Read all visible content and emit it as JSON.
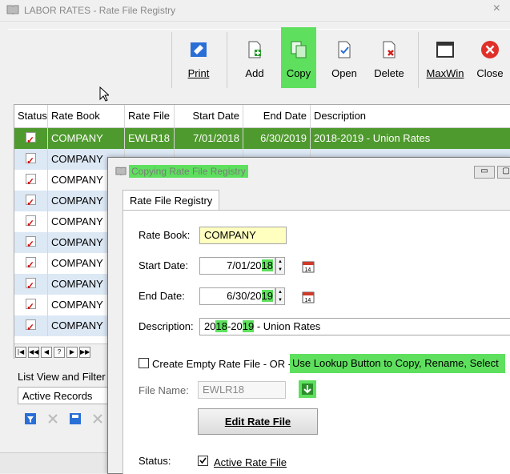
{
  "window": {
    "title": "LABOR RATES - Rate File Registry",
    "close_glyph": "×"
  },
  "toolbar": [
    {
      "id": "print",
      "label": "Print",
      "icon": "print-icon"
    },
    {
      "id": "add",
      "label": "Add",
      "icon": "add-document-icon"
    },
    {
      "id": "copy",
      "label": "Copy",
      "icon": "copy-icon"
    },
    {
      "id": "open",
      "label": "Open",
      "icon": "open-document-icon"
    },
    {
      "id": "delete",
      "label": "Delete",
      "icon": "delete-document-icon"
    },
    {
      "id": "maxwin",
      "label": "MaxWin",
      "icon": "maximize-window-icon"
    },
    {
      "id": "close",
      "label": "Close",
      "icon": "close-circle-icon"
    }
  ],
  "grid": {
    "columns": [
      "Status",
      "Rate Book",
      "Rate File",
      "Start Date",
      "End Date",
      "Description"
    ],
    "rows": [
      {
        "book": "COMPANY",
        "file": "EWLR18",
        "start": "7/01/2018",
        "end": "6/30/2019",
        "desc": "2018-2019 - Union Rates"
      },
      {
        "book": "COMPANY"
      },
      {
        "book": "COMPANY"
      },
      {
        "book": "COMPANY"
      },
      {
        "book": "COMPANY"
      },
      {
        "book": "COMPANY"
      },
      {
        "book": "COMPANY"
      },
      {
        "book": "COMPANY"
      },
      {
        "book": "COMPANY"
      },
      {
        "book": "COMPANY"
      }
    ],
    "nav_glyphs": [
      "|◀",
      "◀◀",
      "◀",
      "?",
      "▶",
      "▶▶"
    ]
  },
  "filter": {
    "label": "List View and Filter",
    "selected": "Active Records"
  },
  "dialog": {
    "title": "Copying Rate File Registry",
    "tab": "Rate File Registry",
    "rate_book_label": "Rate Book:",
    "rate_book_value": "COMPANY",
    "start_label": "Start Date:",
    "start_value_main": "7/01/20",
    "start_value_hl": "18",
    "end_label": "End Date:",
    "end_value_main": "6/30/20",
    "end_value_hl": "19",
    "desc_label": "Description:",
    "desc_parts": [
      "20",
      "18",
      "-20",
      "19",
      " - Union Rates"
    ],
    "create_empty_label": "Create Empty Rate File - OR -",
    "lookup_hint": "Use Lookup Button to Copy, Rename, Select",
    "file_name_label": "File Name:",
    "file_name_value": "EWLR18",
    "edit_button": "Edit Rate File",
    "status_label": "Status:",
    "active_label": "Active Rate File",
    "highlight_color": "#5ee05e",
    "selected_row_color": "#4f9a2e"
  }
}
